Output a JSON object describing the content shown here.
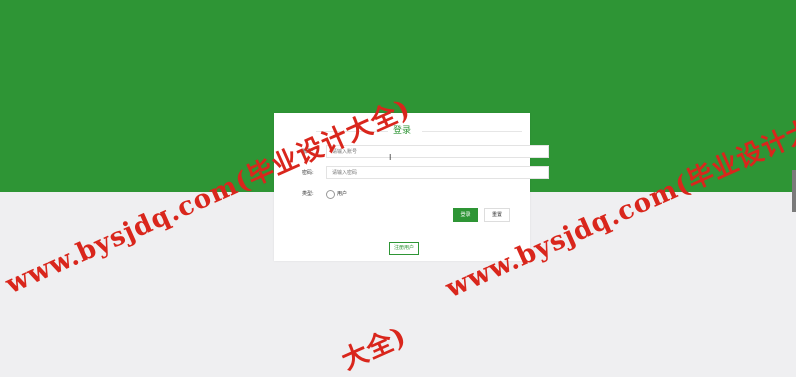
{
  "login": {
    "title": "登录",
    "account_label": "账号:",
    "account_placeholder": "请输入账号",
    "password_label": "密码:",
    "password_placeholder": "请输入密码",
    "type_label": "类型:",
    "type_option": "用户",
    "login_button": "登录",
    "reset_button": "重置",
    "register_button": "注册用户"
  },
  "watermark": {
    "text": "www.bysjdq.com(毕业设计大全)",
    "partial": "大全)"
  },
  "colors": {
    "brand_green": "#2e9535",
    "background": "#efeff1",
    "watermark_red": "#d9261c"
  }
}
